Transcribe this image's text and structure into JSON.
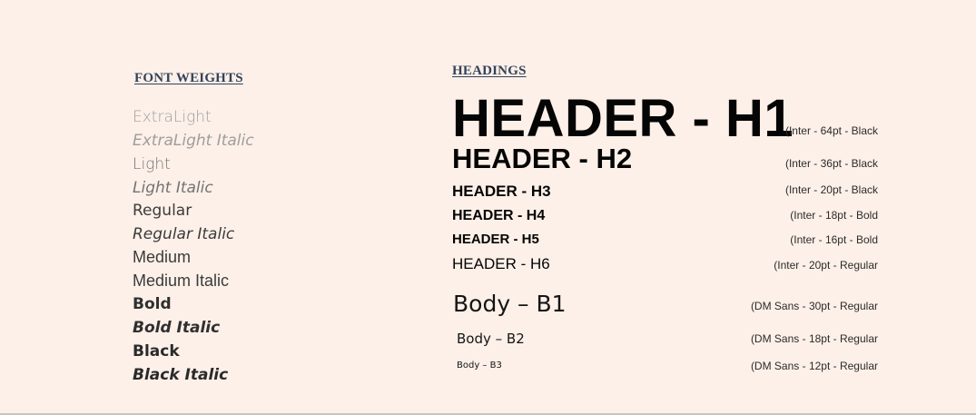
{
  "font_weights": {
    "title": "FONT WEIGHTS",
    "items": [
      "ExtraLight",
      "ExtraLight Italic",
      "Light",
      "Light Italic",
      "Regular",
      "Regular Italic",
      "Medium",
      "Medium Italic",
      "Bold",
      "Bold Italic",
      "Black",
      "Black Italic"
    ]
  },
  "headings": {
    "title": "HEADINGS",
    "items": [
      {
        "label": "HEADER - H1",
        "spec": "(Inter - 64pt - Black"
      },
      {
        "label": "HEADER - H2",
        "spec": "(Inter - 36pt - Black"
      },
      {
        "label": "HEADER - H3",
        "spec": "(Inter - 20pt - Black"
      },
      {
        "label": "HEADER - H4",
        "spec": "(Inter - 18pt - Bold"
      },
      {
        "label": "HEADER - H5",
        "spec": "(Inter - 16pt - Bold"
      },
      {
        "label": "HEADER - H6",
        "spec": "(Inter - 20pt - Regular"
      }
    ]
  },
  "body": {
    "items": [
      {
        "label": "Body – B1",
        "spec": "(DM Sans - 30pt - Regular"
      },
      {
        "label": "Body – B2",
        "spec": "(DM Sans - 18pt - Regular"
      },
      {
        "label": "Body – B3",
        "spec": "(DM Sans - 12pt - Regular"
      }
    ]
  },
  "colors": {
    "background": "#fdf0e8",
    "title": "#33425a",
    "text": "#050505"
  }
}
